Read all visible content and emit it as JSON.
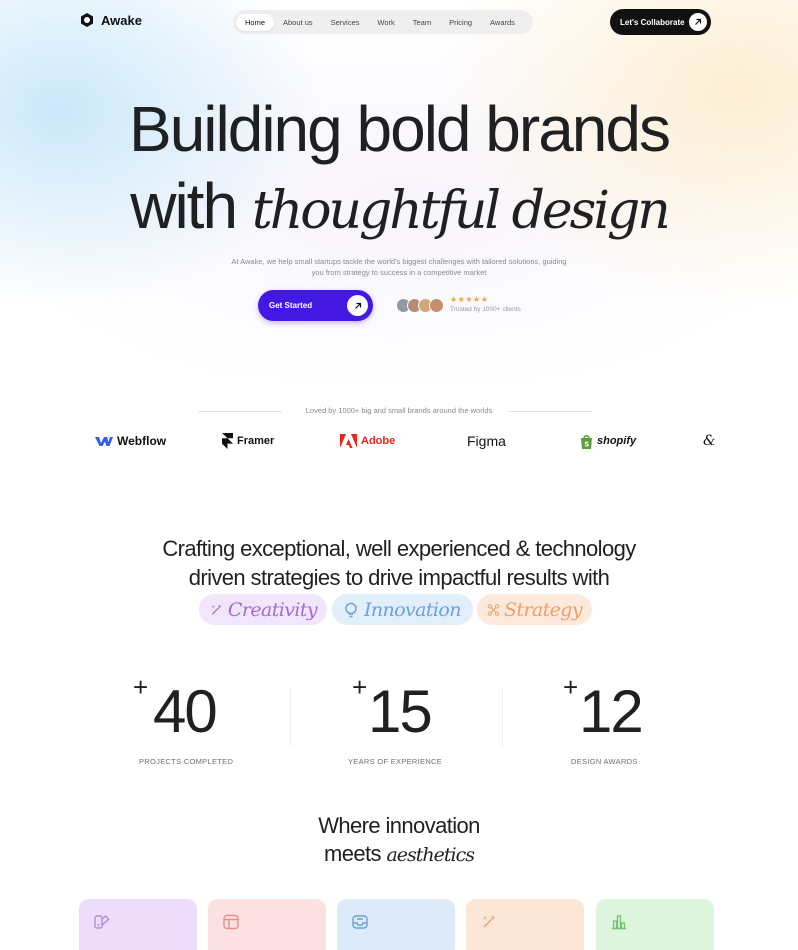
{
  "nav": {
    "logo": "Awake",
    "items": [
      "Home",
      "About us",
      "Services",
      "Work",
      "Team",
      "Pricing",
      "Awards"
    ],
    "active_index": 0,
    "cta_label": "Let's Collaborate"
  },
  "hero": {
    "line1": "Building bold brands",
    "line2_plain": "with",
    "line2_italic": "thoughtful design",
    "subtitle": "At Awake, we help small startups tackle the world's biggest challenges with tailored solutions, guiding you from strategy to success in a competitive market",
    "cta_label": "Get Started",
    "rating_stars": "★★★★★",
    "rating": 5,
    "trusted_text": "Trusted by 1000+ clients"
  },
  "brands": {
    "caption": "Loved by 1000+ big and small brands around the worlds",
    "items": [
      "Webflow",
      "Framer",
      "Adobe",
      "Figma",
      "shopify"
    ]
  },
  "craft": {
    "line1": "Crafting exceptional, well experienced & technology",
    "line2": "driven strategies to drive impactful results with",
    "chips": [
      {
        "label": "Creativity",
        "icon": "magic-wand-icon",
        "bg": "#f1e6fb",
        "fg": "#a36bd8"
      },
      {
        "label": "Innovation",
        "icon": "lightbulb-icon",
        "bg": "#e3eefb",
        "fg": "#6aa1e0"
      },
      {
        "label": "Strategy",
        "icon": "nodes-icon",
        "bg": "#fdeadd",
        "fg": "#ee9e69"
      }
    ]
  },
  "stats": [
    {
      "plus": "+",
      "value": "40",
      "label": "PROJECTS COMPLETED"
    },
    {
      "plus": "+",
      "value": "15",
      "label": "YEARS OF  EXPERIENCE"
    },
    {
      "plus": "+",
      "value": "12",
      "label": "DESIGN  AWARDS"
    }
  ],
  "where": {
    "line1": "Where innovation",
    "line2_plain": "meets",
    "line2_italic": "aesthetics"
  },
  "cards": [
    {
      "icon": "brand-kit-icon",
      "bg": "#eddcfa",
      "fg": "#b48ad9"
    },
    {
      "icon": "window-icon",
      "bg": "#fbe1e1",
      "fg": "#e58f8f"
    },
    {
      "icon": "inbox-icon",
      "bg": "#ddeaf9",
      "fg": "#6d9fd6"
    },
    {
      "icon": "magic-wand-icon",
      "bg": "#fce6d6",
      "fg": "#e9a271"
    },
    {
      "icon": "bar-chart-icon",
      "bg": "#dcf5dc",
      "fg": "#73c275"
    }
  ],
  "colors": {
    "accent": "#4318e3",
    "text": "#1f2022",
    "star": "#f2a33a"
  }
}
